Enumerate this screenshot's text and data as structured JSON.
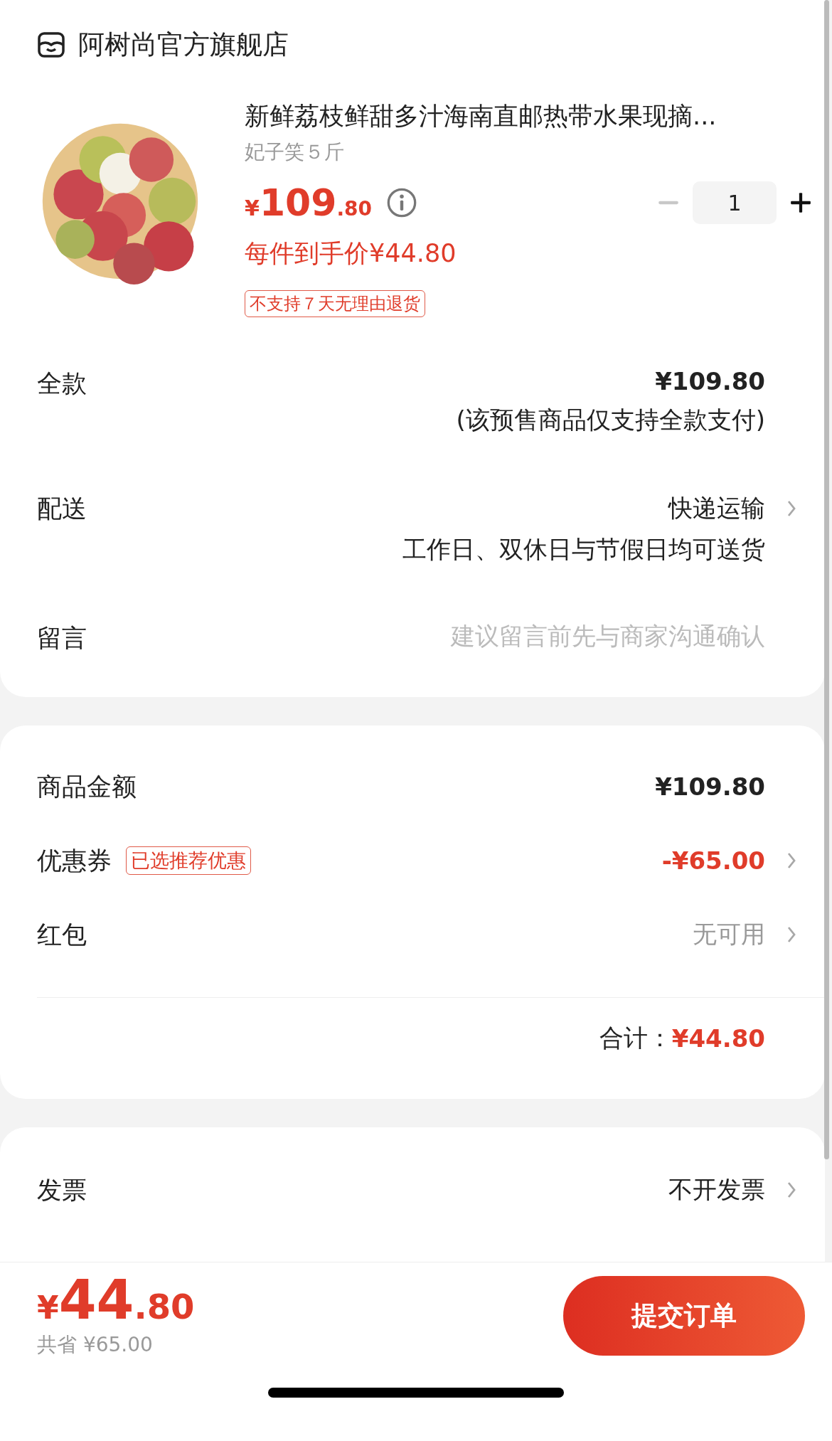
{
  "store": {
    "name": "阿树尚官方旗舰店"
  },
  "product": {
    "kind": "picture",
    "title": "新鲜荔枝鲜甜多汁海南直邮热带水果现摘...",
    "spec": "妃子笑５斤",
    "price_symbol": "¥",
    "price_int": "109",
    "price_dec": ".80",
    "unit_price": "每件到手价¥44.80",
    "quantity": "1",
    "tag": "不支持７天无理由退货"
  },
  "order_rows": [
    {
      "label": "全款",
      "value": "¥109.80",
      "note": "(该预售商品仅支持全款支付)",
      "kind": "bold",
      "arrow": false
    },
    {
      "label": "配送",
      "value": "快递运输",
      "note": "工作日、双休日与节假日均可送货",
      "kind": "plain",
      "arrow": true
    },
    {
      "label": "留言",
      "placeholder": "建议留言前先与商家沟通确认",
      "kind": "input",
      "arrow": false
    }
  ],
  "price_rows": [
    {
      "label": "商品金额",
      "value": "¥109.80",
      "kind": "bold",
      "arrow": false
    },
    {
      "label": "优惠券",
      "badge": "已选推荐优惠",
      "value": "-¥65.00",
      "kind": "red",
      "arrow": true
    },
    {
      "label": "红包",
      "value": "无可用",
      "kind": "muted",
      "arrow": true
    }
  ],
  "total": {
    "label": "合计：",
    "value": "¥44.80"
  },
  "invoice_rows": [
    {
      "label": "发票",
      "value": "不开发票",
      "arrow": true
    }
  ],
  "bottom_bar": {
    "symbol": "¥",
    "price_int": "44",
    "price_dec": ".80",
    "saved": "共省 ¥65.00",
    "submit": "提交订单"
  }
}
